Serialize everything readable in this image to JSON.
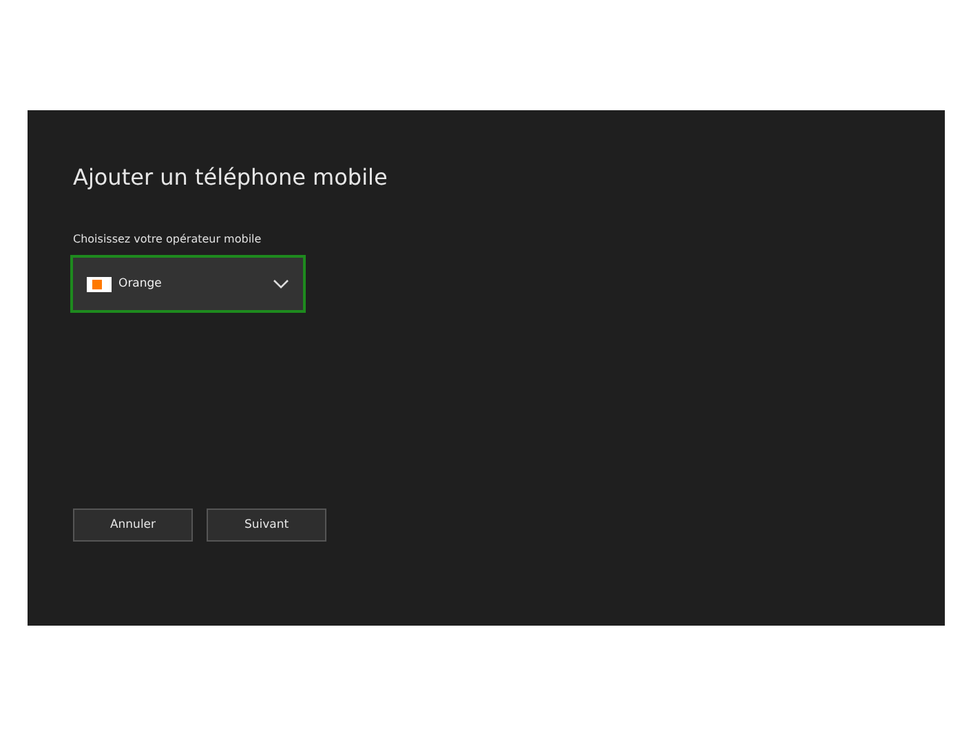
{
  "dialog": {
    "title": "Ajouter un téléphone mobile"
  },
  "operator_select": {
    "label": "Choisissez votre opérateur mobile",
    "value": "Orange",
    "focused": true
  },
  "buttons": [
    {
      "label": "Annuler"
    },
    {
      "label": "Suivant"
    }
  ]
}
